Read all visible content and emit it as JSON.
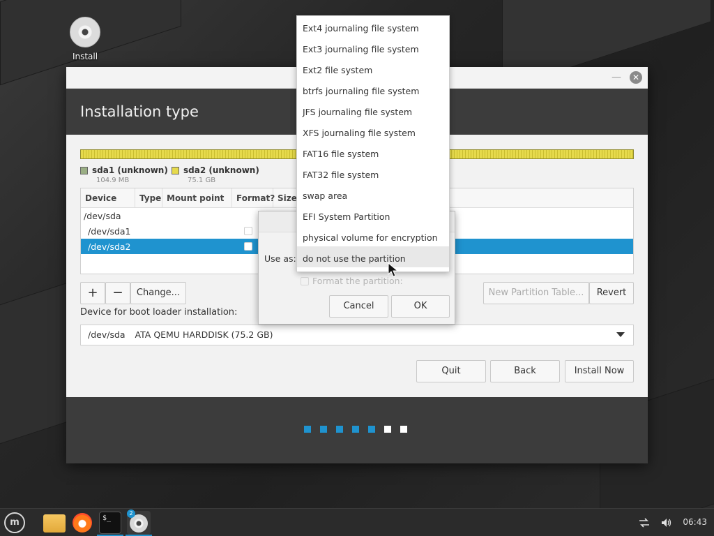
{
  "desktop": {
    "icon_label": "Install"
  },
  "window": {
    "header_title": "Installation type",
    "close_glyph": "✕",
    "min_glyph": "—"
  },
  "partitions": [
    {
      "name": "sda1 (unknown)",
      "size": "104.9 MB",
      "color": "#9aae84"
    },
    {
      "name": "sda2 (unknown)",
      "size": "75.1 GB",
      "color": "#e6da4c"
    }
  ],
  "table": {
    "headers": [
      "Device",
      "Type",
      "Mount point",
      "Format?",
      "Size"
    ],
    "rows": [
      "/dev/sda",
      "/dev/sda1",
      "/dev/sda2"
    ],
    "selected_index": 2
  },
  "buttons": {
    "add": "+",
    "remove": "—",
    "change": "Change...",
    "new_table": "New Partition Table...",
    "revert": "Revert",
    "quit": "Quit",
    "back": "Back",
    "install": "Install Now"
  },
  "bootloader": {
    "label": "Device for boot loader installation:",
    "device": "/dev/sda",
    "description": "ATA QEMU HARDDISK (75.2 GB)"
  },
  "progress_dots": {
    "total": 7,
    "completed": 5,
    "active_color": "#1f93cf",
    "pending_color": "#ffffff"
  },
  "dialog": {
    "use_as_label": "Use as:",
    "format_label": "Format the partition:",
    "cancel": "Cancel",
    "ok": "OK"
  },
  "use_as_options": [
    "Ext4 journaling file system",
    "Ext3 journaling file system",
    "Ext2 file system",
    "btrfs journaling file system",
    "JFS journaling file system",
    "XFS journaling file system",
    "FAT16 file system",
    "FAT32 file system",
    "swap area",
    "EFI System Partition",
    "physical volume for encryption",
    "do not use the partition"
  ],
  "use_as_hover_index": 11,
  "taskbar": {
    "terminal_glyph": "$_",
    "badge": "2",
    "time": "06:43",
    "network_icon": "network-icon",
    "volume_icon": "volume-icon"
  }
}
